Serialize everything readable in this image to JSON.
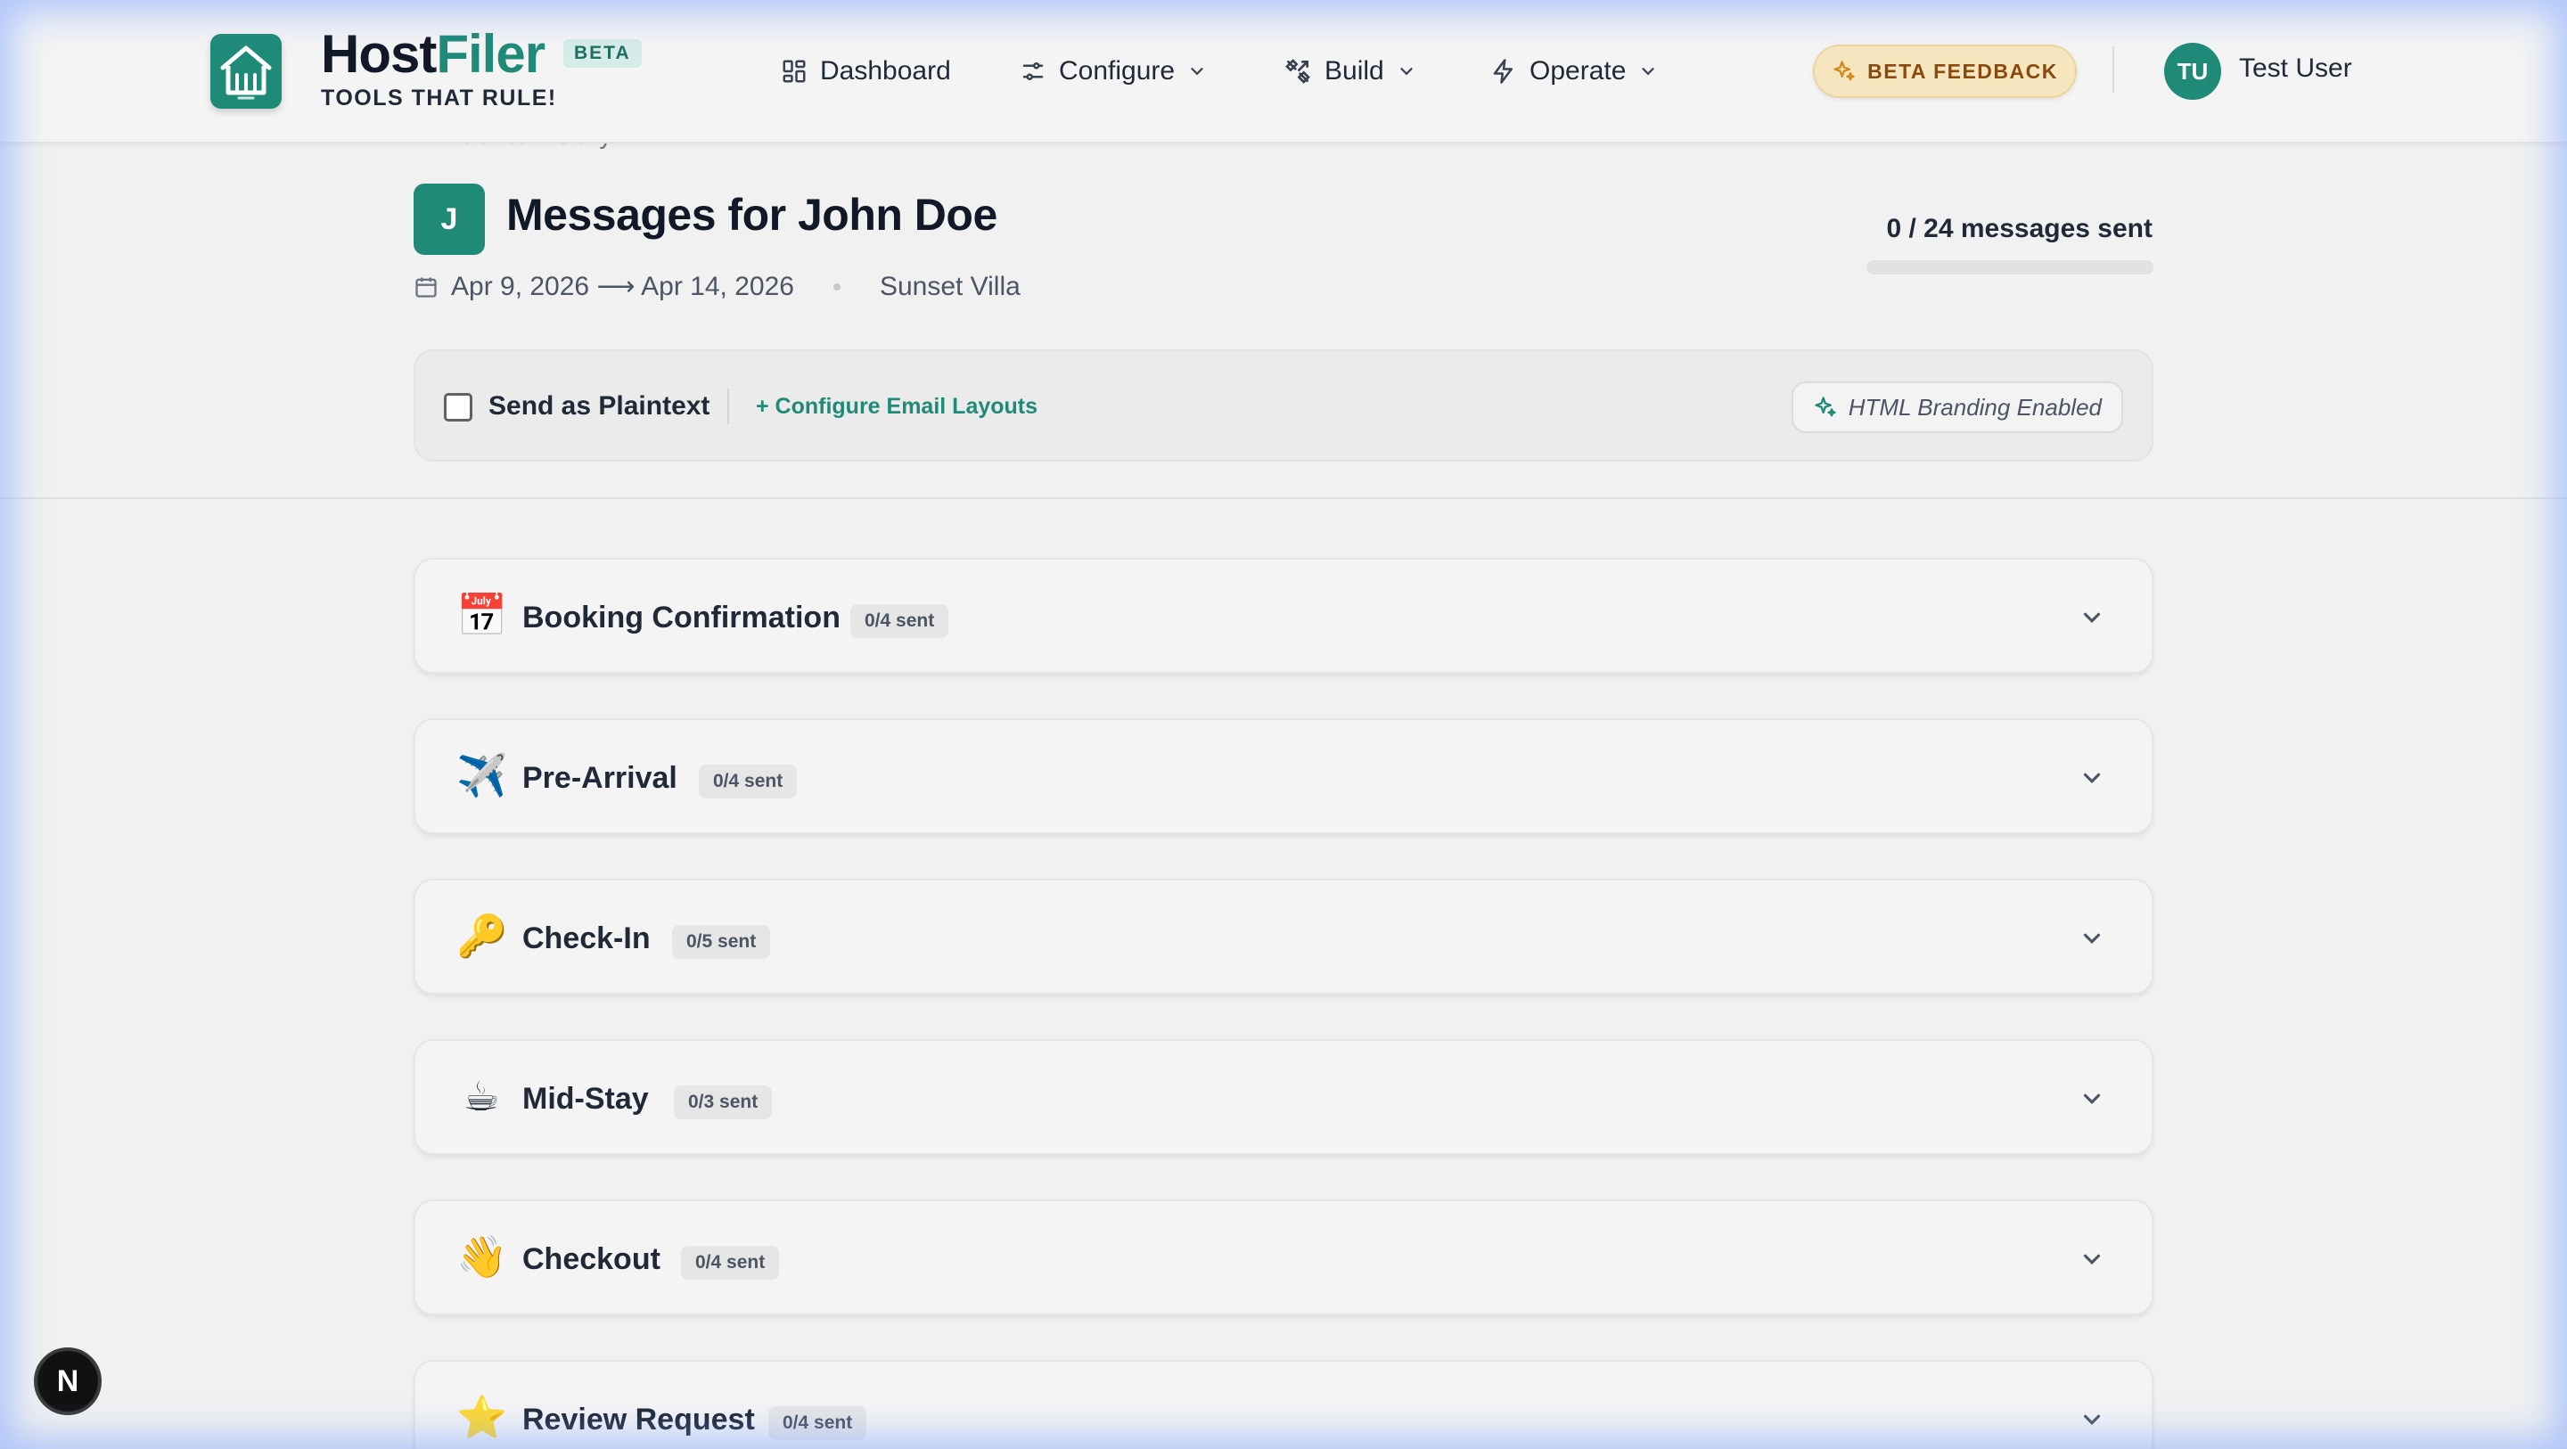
{
  "header": {
    "brand_host": "Host",
    "brand_filer": "Filer",
    "beta_badge": "BETA",
    "tagline": "TOOLS THAT RULE!",
    "nav": [
      {
        "label": "Dashboard",
        "icon": "grid-icon"
      },
      {
        "label": "Configure",
        "icon": "sliders-icon"
      },
      {
        "label": "Build",
        "icon": "tools-icon"
      },
      {
        "label": "Operate",
        "icon": "bolt-icon"
      }
    ],
    "feedback_label": "BETA FEEDBACK",
    "user_initials": "TU",
    "user_name": "Test User"
  },
  "page": {
    "back_link": "← Back to Library",
    "contact_initial": "J",
    "title": "Messages for John Doe",
    "date_range": "Apr 9, 2026 ⟶ Apr 14, 2026",
    "property": "Sunset Villa",
    "sent_summary": "0 / 24 messages sent",
    "sent_progress": 0
  },
  "options": {
    "plaintext_label": "Send as Plaintext",
    "plaintext_checked": false,
    "configure_layouts": "+ Configure Email Layouts",
    "branding_label": "HTML Branding Enabled"
  },
  "sections": [
    {
      "emoji": "📅",
      "title": "Booking Confirmation",
      "badge": "0/4 sent"
    },
    {
      "emoji": "✈️",
      "title": "Pre-Arrival",
      "badge": "0/4 sent"
    },
    {
      "emoji": "🔑",
      "title": "Check-In",
      "badge": "0/5 sent"
    },
    {
      "emoji": "☕",
      "title": "Mid-Stay",
      "badge": "0/3 sent"
    },
    {
      "emoji": "👋",
      "title": "Checkout",
      "badge": "0/4 sent"
    },
    {
      "emoji": "⭐",
      "title": "Review Request",
      "badge": "0/4 sent"
    }
  ],
  "dev_badge": "N",
  "colors": {
    "accent": "#1f8a78",
    "feedback_bg": "#f6e6bf",
    "feedback_text": "#8a4a0e"
  }
}
